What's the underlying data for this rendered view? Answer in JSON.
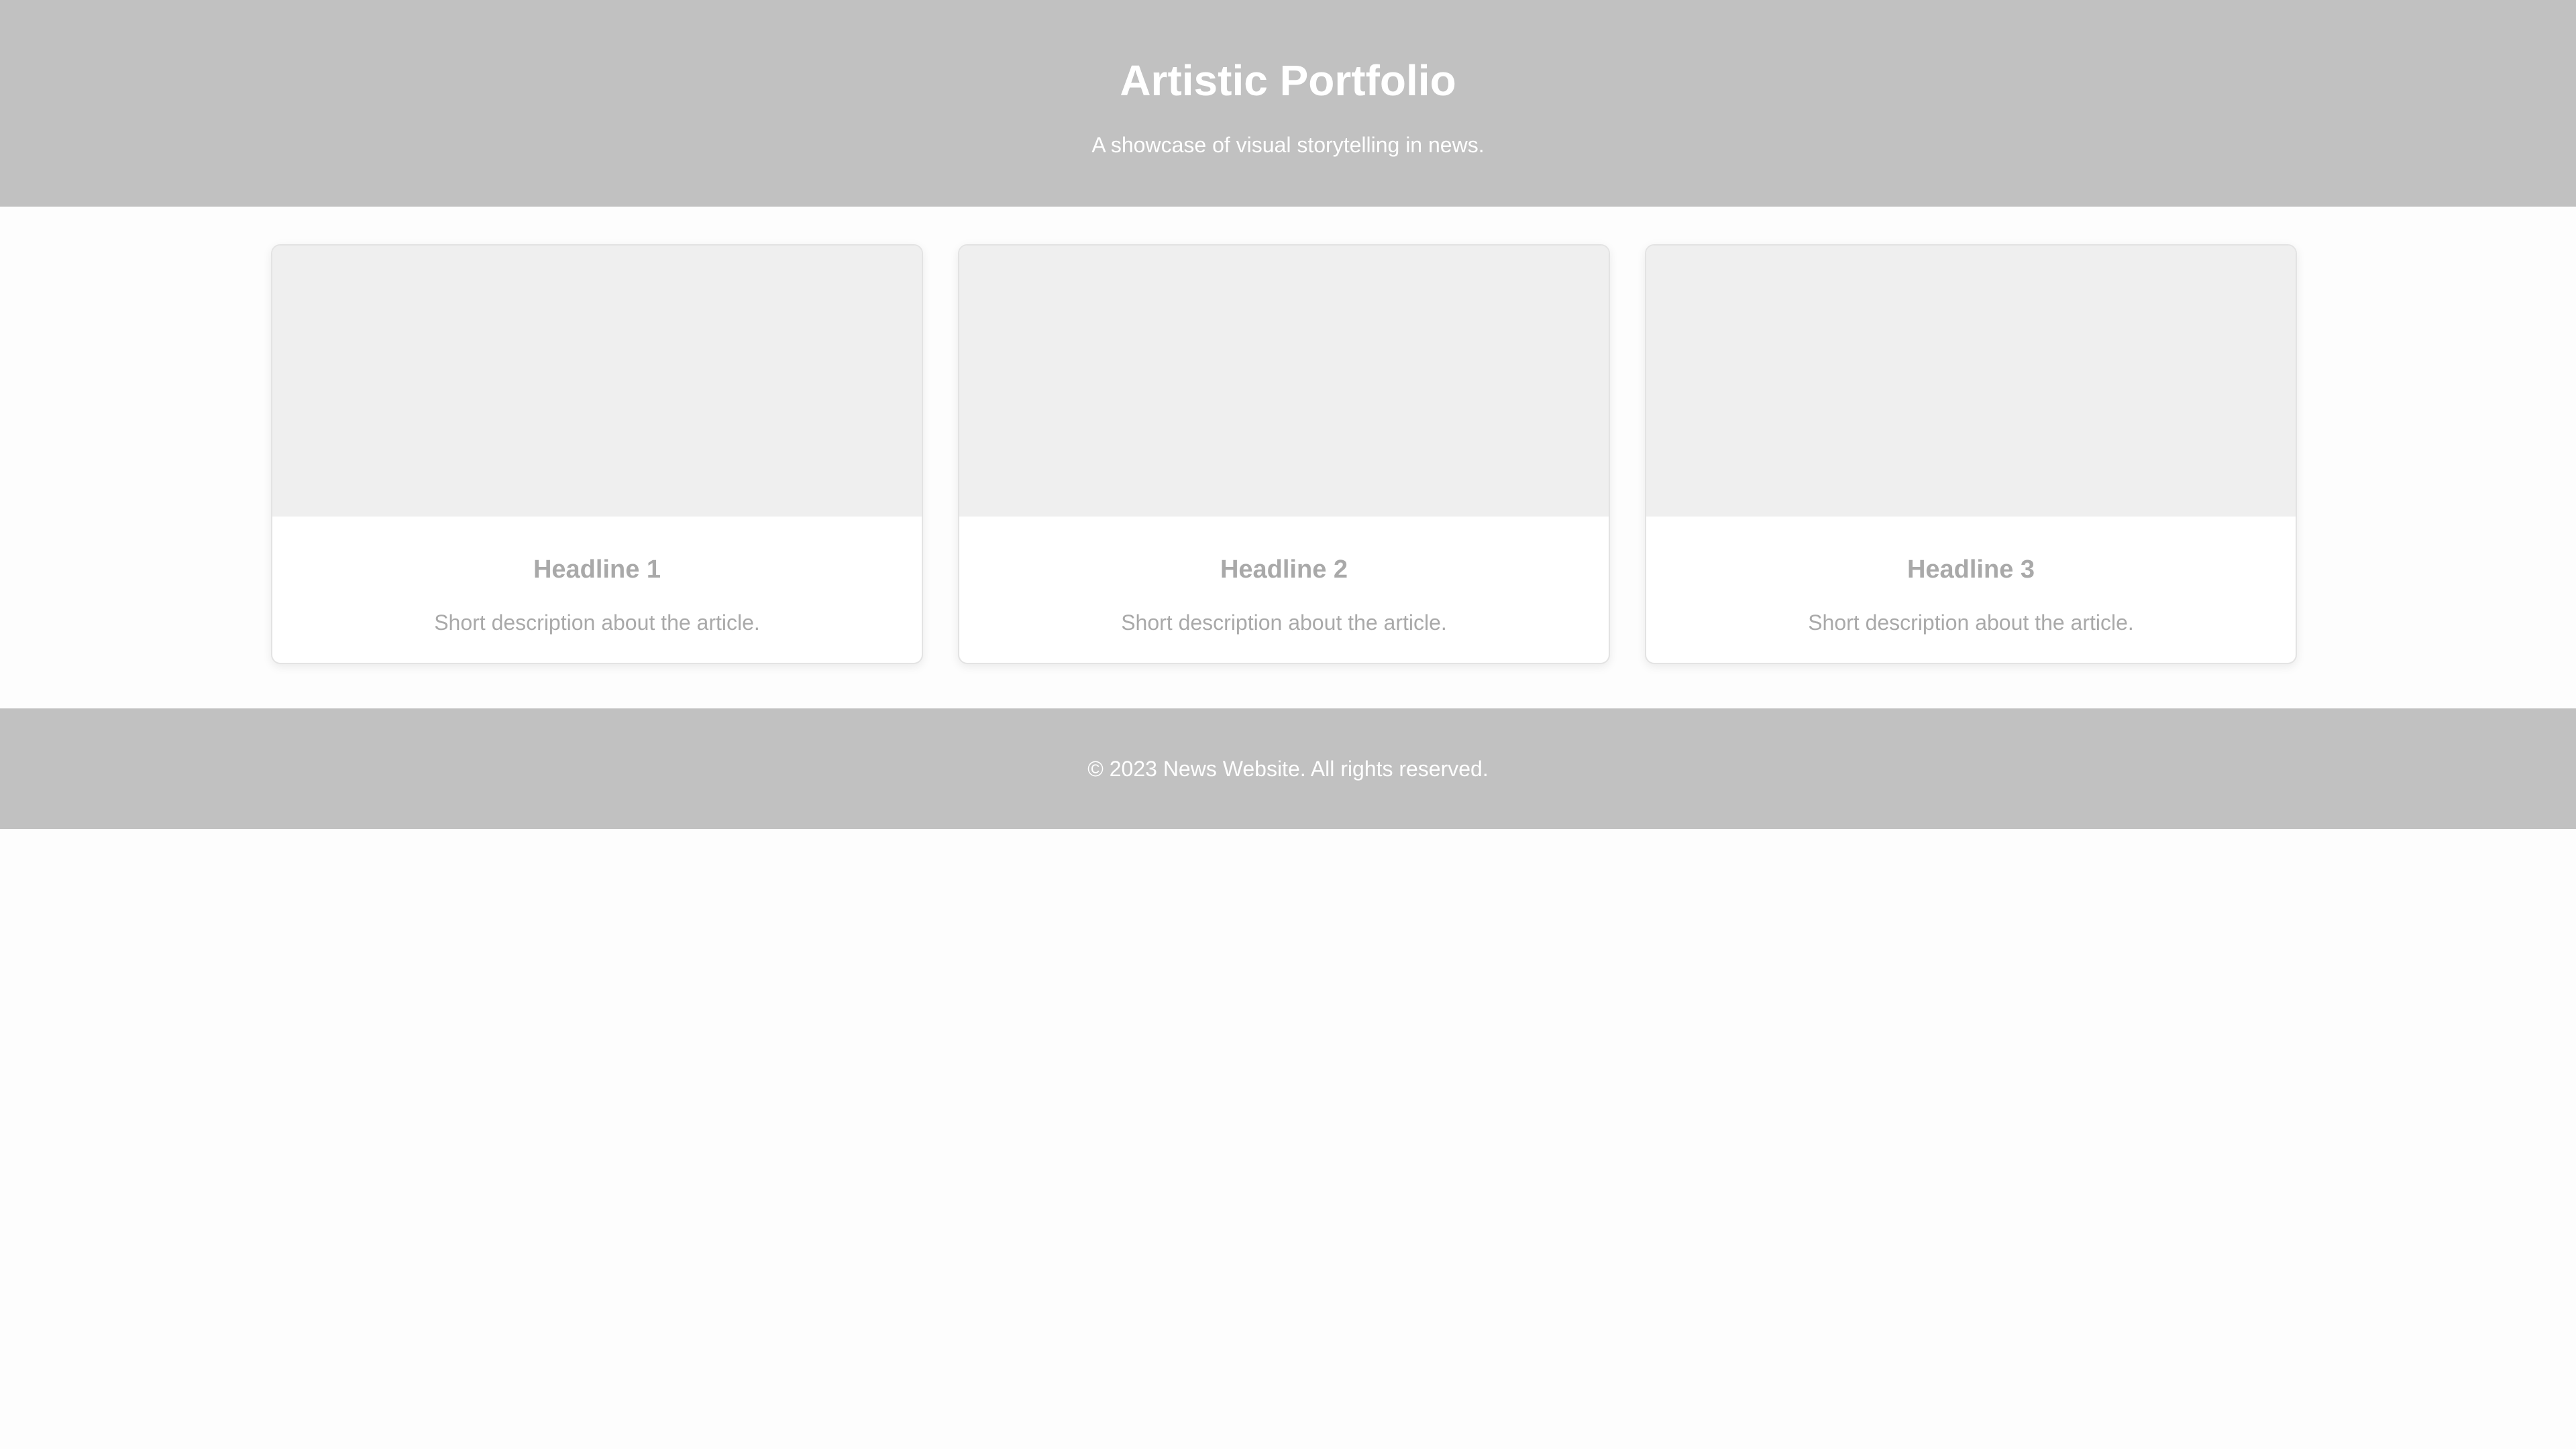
{
  "header": {
    "title": "Artistic Portfolio",
    "subtitle": "A showcase of visual storytelling in news."
  },
  "articles": [
    {
      "headline": "Headline 1",
      "description": "Short description about the article."
    },
    {
      "headline": "Headline 2",
      "description": "Short description about the article."
    },
    {
      "headline": "Headline 3",
      "description": "Short description about the article."
    }
  ],
  "footer": {
    "text": "© 2023 News Website. All rights reserved."
  },
  "colors": {
    "header_bg": "#c1c1c1",
    "card_image_bg": "#efefef",
    "card_text": "#a9a9a9",
    "page_bg": "#fdfdfd"
  }
}
